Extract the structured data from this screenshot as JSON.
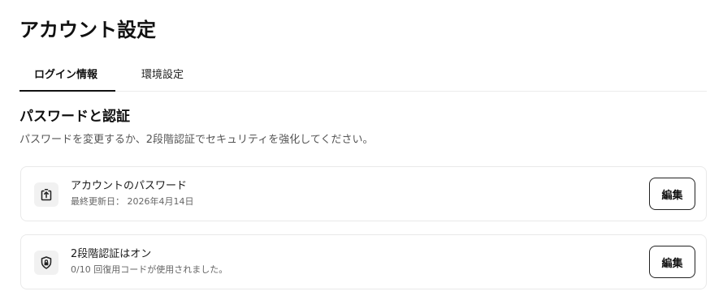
{
  "page": {
    "title": "アカウント設定"
  },
  "tabs": [
    {
      "label": "ログイン情報",
      "active": true
    },
    {
      "label": "環境設定",
      "active": false
    }
  ],
  "section": {
    "title": "パスワードと認証",
    "description": "パスワードを変更するか、2段階認証でセキュリティを強化してください。"
  },
  "cards": [
    {
      "icon": "password-upload-icon",
      "title": "アカウントのパスワード",
      "subtitle": "最終更新日： 2026年4月14日",
      "button_label": "編集"
    },
    {
      "icon": "shield-lock-icon",
      "title": "2段階認証はオン",
      "subtitle": "0/10 回復用コードが使用されました。",
      "button_label": "編集"
    }
  ],
  "colors": {
    "text": "#1a1a1a",
    "muted": "#555555",
    "border": "#e9e9e9",
    "icon_bg": "#f1f1f1",
    "accent": "#111111"
  }
}
